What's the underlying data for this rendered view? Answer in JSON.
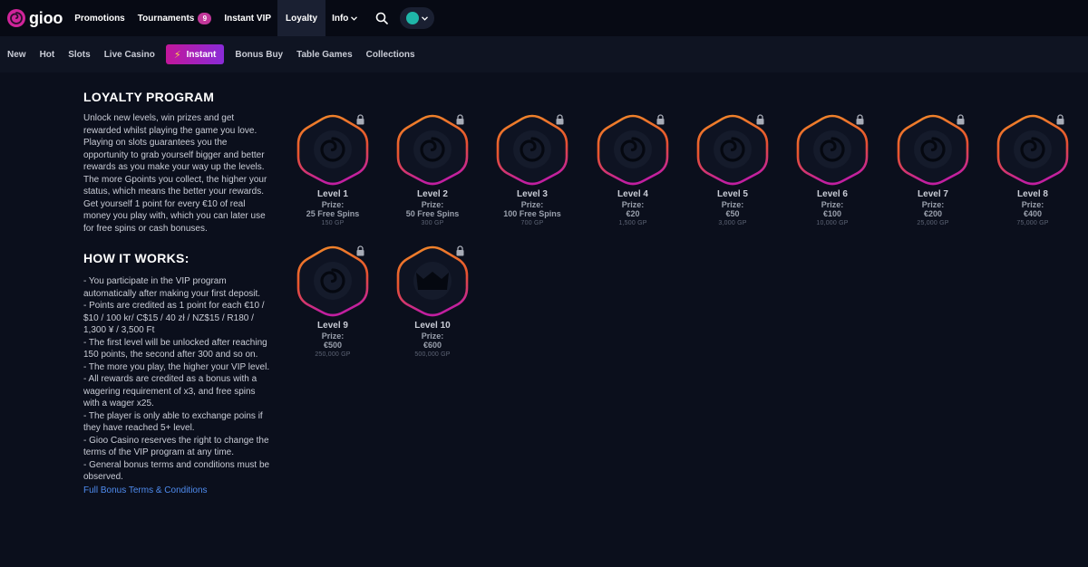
{
  "header": {
    "logo_text": "gioo",
    "nav": [
      {
        "label": "Promotions"
      },
      {
        "label": "Tournaments",
        "badge": "9"
      },
      {
        "label": "Instant VIP"
      },
      {
        "label": "Loyalty",
        "active": true
      },
      {
        "label": "Info"
      }
    ],
    "accent_color": "#c2379a"
  },
  "categories": [
    "New",
    "Hot",
    "Slots",
    "Live Casino",
    "Instant",
    "Bonus Buy",
    "Table Games",
    "Collections"
  ],
  "loyalty": {
    "title": "LOYALTY PROGRAM",
    "intro": "Unlock new levels, win prizes and get rewarded whilst playing the game you love. Playing on slots guarantees you the opportunity to grab yourself bigger and better rewards as you make your way up the levels. The more Gpoints you collect, the higher your status, which means the better your rewards. Get yourself 1 point for every €10 of real money you play with, which you can later use for free spins or cash bonuses.",
    "how_title": "HOW IT WORKS:",
    "rules": [
      "- You participate in the VIP program automatically after making your first deposit.",
      "- Points are credited as 1 point for each €10 / $10 / 100 kr/ C$15 / 40 zł / NZ$15 / R180 / 1,300 ¥ / 3,500 Ft",
      "- The first level will be unlocked after reaching 150 points, the second after 300 and so on.",
      "- The more you play, the higher your VIP level.",
      "- All rewards are credited as a bonus with a wagering requirement of x3, and free spins with a wager x25.",
      "- The player is only able to exchange poins if they have reached 5+ level.",
      "- Gioo Casino reserves the right to change the terms of the VIP program at any time.",
      "- General bonus terms and conditions must be observed."
    ],
    "terms_link": "Full Bonus Terms & Conditions"
  },
  "levels": [
    {
      "name": "Level 1",
      "prize_label": "Prize:",
      "prize": "25 Free Spins",
      "gp": "150 GP",
      "icon": "spiral-icon"
    },
    {
      "name": "Level 2",
      "prize_label": "Prize:",
      "prize": "50 Free Spins",
      "gp": "300 GP",
      "icon": "spiral-icon"
    },
    {
      "name": "Level 3",
      "prize_label": "Prize:",
      "prize": "100 Free Spins",
      "gp": "700 GP",
      "icon": "spiral-icon"
    },
    {
      "name": "Level 4",
      "prize_label": "Prize:",
      "prize": "€20",
      "gp": "1,500 GP",
      "icon": "spiral-icon"
    },
    {
      "name": "Level 5",
      "prize_label": "Prize:",
      "prize": "€50",
      "gp": "3,000 GP",
      "icon": "spiral-icon"
    },
    {
      "name": "Level 6",
      "prize_label": "Prize:",
      "prize": "€100",
      "gp": "10,000 GP",
      "icon": "spiral-icon"
    },
    {
      "name": "Level 7",
      "prize_label": "Prize:",
      "prize": "€200",
      "gp": "25,000 GP",
      "icon": "spiral-icon"
    },
    {
      "name": "Level 8",
      "prize_label": "Prize:",
      "prize": "€400",
      "gp": "75,000 GP",
      "icon": "spiral-icon"
    },
    {
      "name": "Level 9",
      "prize_label": "Prize:",
      "prize": "€500",
      "gp": "250,000 GP",
      "icon": "spiral-icon"
    },
    {
      "name": "Level 10",
      "prize_label": "Prize:",
      "prize": "€600",
      "gp": "500,000 GP",
      "icon": "crown-icon"
    }
  ]
}
